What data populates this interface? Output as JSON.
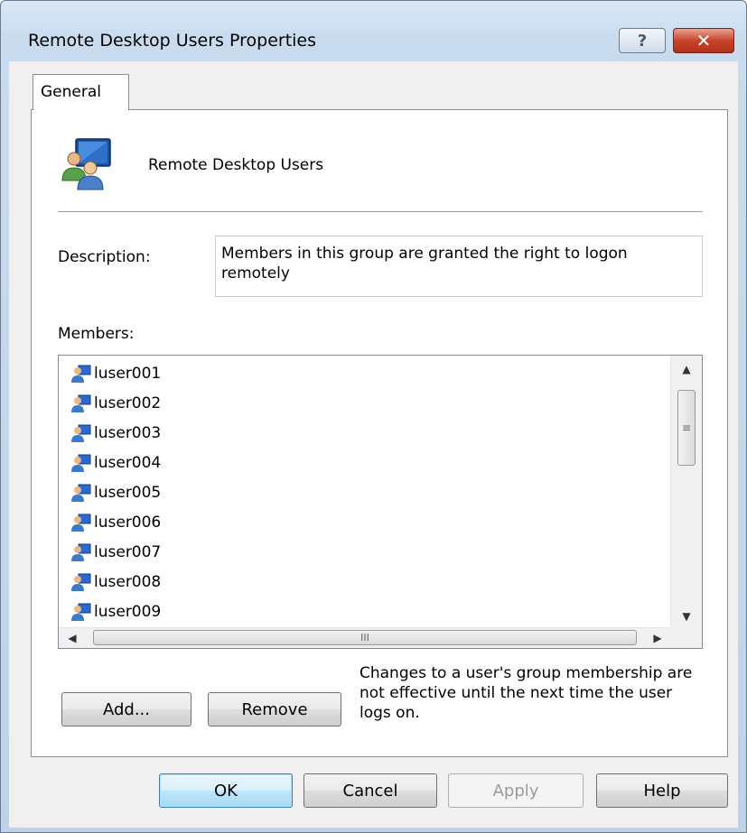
{
  "window": {
    "title": "Remote Desktop Users Properties",
    "help_glyph": "?",
    "close_glyph": "✕"
  },
  "tabs": [
    {
      "label": "General"
    }
  ],
  "group": {
    "name": "Remote Desktop Users"
  },
  "description": {
    "label": "Description:",
    "value": "Members in this group are granted the right to logon remotely"
  },
  "members": {
    "label": "Members:",
    "items": [
      "luser001",
      "luser002",
      "luser003",
      "luser004",
      "luser005",
      "luser006",
      "luser007",
      "luser008",
      "luser009"
    ],
    "hscroll_grip": "III",
    "vscroll_grip": "≡"
  },
  "buttons": {
    "add": "Add...",
    "remove": "Remove",
    "ok": "OK",
    "cancel": "Cancel",
    "apply": "Apply",
    "help": "Help"
  },
  "note": "Changes to a user's group membership are not effective until the next time the user logs on.",
  "colors": {
    "titlebar": "#c9dcef",
    "close": "#c7442b",
    "default_button_border": "#3c7fb1"
  }
}
